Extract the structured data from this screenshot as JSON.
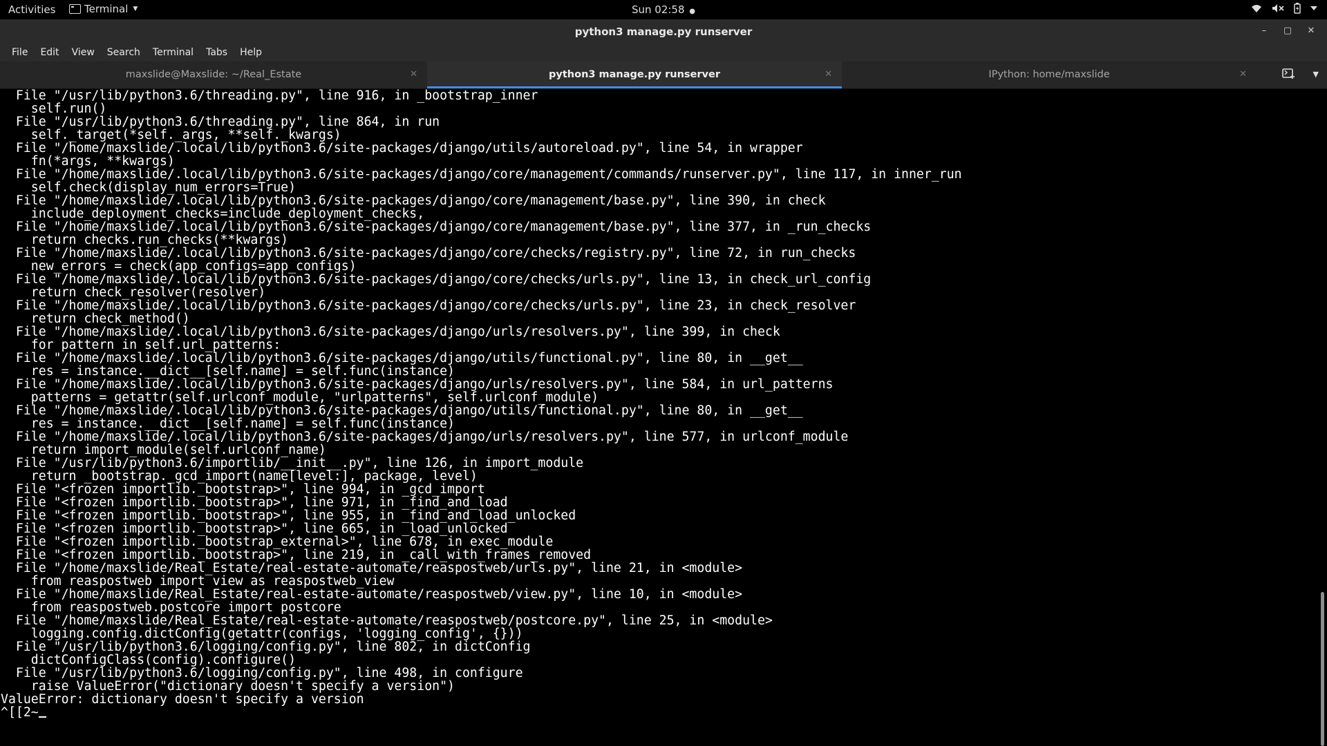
{
  "topbar": {
    "activities": "Activities",
    "app_name": "Terminal",
    "clock": "Sun 02:58",
    "clock_dot": "●",
    "tray": [
      "wifi-icon",
      "volume-muted-icon",
      "battery-icon",
      "power-menu-icon"
    ]
  },
  "window": {
    "title": "python3 manage.py runserver",
    "controls": [
      "–",
      "▢",
      "✕"
    ]
  },
  "menubar": {
    "items": [
      "File",
      "Edit",
      "View",
      "Search",
      "Terminal",
      "Tabs",
      "Help"
    ]
  },
  "tabs": [
    {
      "label": "maxslide@Maxslide: ~/Real_Estate",
      "active": false
    },
    {
      "label": "python3 manage.py runserver",
      "active": true
    },
    {
      "label": "IPython: home/maxslide",
      "active": false
    }
  ],
  "terminal": {
    "lines": [
      "  File \"/usr/lib/python3.6/threading.py\", line 916, in _bootstrap_inner",
      "    self.run()",
      "  File \"/usr/lib/python3.6/threading.py\", line 864, in run",
      "    self._target(*self._args, **self._kwargs)",
      "  File \"/home/maxslide/.local/lib/python3.6/site-packages/django/utils/autoreload.py\", line 54, in wrapper",
      "    fn(*args, **kwargs)",
      "  File \"/home/maxslide/.local/lib/python3.6/site-packages/django/core/management/commands/runserver.py\", line 117, in inner_run",
      "    self.check(display_num_errors=True)",
      "  File \"/home/maxslide/.local/lib/python3.6/site-packages/django/core/management/base.py\", line 390, in check",
      "    include_deployment_checks=include_deployment_checks,",
      "  File \"/home/maxslide/.local/lib/python3.6/site-packages/django/core/management/base.py\", line 377, in _run_checks",
      "    return checks.run_checks(**kwargs)",
      "  File \"/home/maxslide/.local/lib/python3.6/site-packages/django/core/checks/registry.py\", line 72, in run_checks",
      "    new_errors = check(app_configs=app_configs)",
      "  File \"/home/maxslide/.local/lib/python3.6/site-packages/django/core/checks/urls.py\", line 13, in check_url_config",
      "    return check_resolver(resolver)",
      "  File \"/home/maxslide/.local/lib/python3.6/site-packages/django/core/checks/urls.py\", line 23, in check_resolver",
      "    return check_method()",
      "  File \"/home/maxslide/.local/lib/python3.6/site-packages/django/urls/resolvers.py\", line 399, in check",
      "    for pattern in self.url_patterns:",
      "  File \"/home/maxslide/.local/lib/python3.6/site-packages/django/utils/functional.py\", line 80, in __get__",
      "    res = instance.__dict__[self.name] = self.func(instance)",
      "  File \"/home/maxslide/.local/lib/python3.6/site-packages/django/urls/resolvers.py\", line 584, in url_patterns",
      "    patterns = getattr(self.urlconf_module, \"urlpatterns\", self.urlconf_module)",
      "  File \"/home/maxslide/.local/lib/python3.6/site-packages/django/utils/functional.py\", line 80, in __get__",
      "    res = instance.__dict__[self.name] = self.func(instance)",
      "  File \"/home/maxslide/.local/lib/python3.6/site-packages/django/urls/resolvers.py\", line 577, in urlconf_module",
      "    return import_module(self.urlconf_name)",
      "  File \"/usr/lib/python3.6/importlib/__init__.py\", line 126, in import_module",
      "    return _bootstrap._gcd_import(name[level:], package, level)",
      "  File \"<frozen importlib._bootstrap>\", line 994, in _gcd_import",
      "  File \"<frozen importlib._bootstrap>\", line 971, in _find_and_load",
      "  File \"<frozen importlib._bootstrap>\", line 955, in _find_and_load_unlocked",
      "  File \"<frozen importlib._bootstrap>\", line 665, in _load_unlocked",
      "  File \"<frozen importlib._bootstrap_external>\", line 678, in exec_module",
      "  File \"<frozen importlib._bootstrap>\", line 219, in _call_with_frames_removed",
      "  File \"/home/maxslide/Real_Estate/real-estate-automate/reaspostweb/urls.py\", line 21, in <module>",
      "    from reaspostweb import view as reaspostweb_view",
      "  File \"/home/maxslide/Real_Estate/real-estate-automate/reaspostweb/view.py\", line 10, in <module>",
      "    from reaspostweb.postcore import postcore",
      "  File \"/home/maxslide/Real_Estate/real-estate-automate/reaspostweb/postcore.py\", line 25, in <module>",
      "    logging.config.dictConfig(getattr(configs, 'logging_config', {}))",
      "  File \"/usr/lib/python3.6/logging/config.py\", line 802, in dictConfig",
      "    dictConfigClass(config).configure()",
      "  File \"/usr/lib/python3.6/logging/config.py\", line 498, in configure",
      "    raise ValueError(\"dictionary doesn't specify a version\")",
      "ValueError: dictionary doesn't specify a version"
    ],
    "prompt_input": "^[[2~"
  }
}
